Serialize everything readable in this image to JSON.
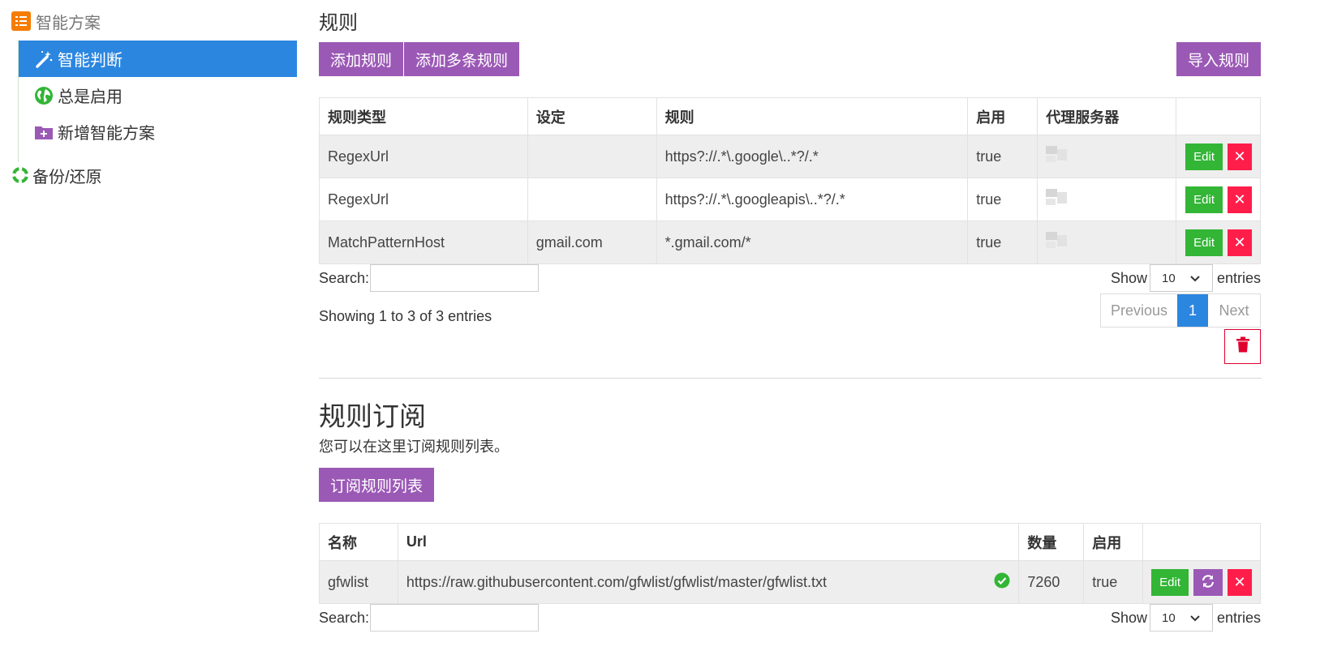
{
  "sidebar": {
    "group_title": "智能方案",
    "items": [
      {
        "label": "智能判断",
        "icon": "magic-wand-icon",
        "active": true
      },
      {
        "label": "总是启用",
        "icon": "globe-icon",
        "active": false
      },
      {
        "label": "新增智能方案",
        "icon": "folder-plus-icon",
        "active": false
      }
    ],
    "backup_label": "备份/还原"
  },
  "rules": {
    "title": "规则",
    "add_rule_label": "添加规则",
    "add_multi_label": "添加多条规则",
    "import_label": "导入规则",
    "columns": [
      "规则类型",
      "设定",
      "规则",
      "启用",
      "代理服务器",
      ""
    ],
    "rows": [
      {
        "type": "RegexUrl",
        "setting": "",
        "rule": "https?://.*\\.google\\..*?/.*",
        "enabled": "true"
      },
      {
        "type": "RegexUrl",
        "setting": "",
        "rule": "https?://.*\\.googleapis\\..*?/.*",
        "enabled": "true"
      },
      {
        "type": "MatchPatternHost",
        "setting": "gmail.com",
        "rule": "*.gmail.com/*",
        "enabled": "true"
      }
    ],
    "edit_label": "Edit",
    "delete_glyph": "✕",
    "search_label": "Search:",
    "show_label": "Show",
    "show_value": "10",
    "entries_label": "entries",
    "info": "Showing 1 to 3 of 3 entries",
    "pager": {
      "prev": "Previous",
      "current": "1",
      "next": "Next"
    }
  },
  "subscriptions": {
    "title": "规则订阅",
    "description": "您可以在这里订阅规则列表。",
    "subscribe_label": "订阅规则列表",
    "columns": [
      "名称",
      "Url",
      "数量",
      "启用",
      ""
    ],
    "rows": [
      {
        "name": "gfwlist",
        "url": "https://raw.githubusercontent.com/gfwlist/gfwlist/master/gfwlist.txt",
        "count": "7260",
        "enabled": "true"
      }
    ],
    "edit_label": "Edit",
    "delete_glyph": "✕",
    "search_label": "Search:",
    "show_label": "Show",
    "show_value": "10",
    "entries_label": "entries"
  },
  "colors": {
    "accent_purple": "#9b59b6",
    "active_blue": "#2b86e0",
    "edit_green": "#33b536",
    "delete_red": "#ff1e4a",
    "logo_orange": "#f57c00"
  }
}
